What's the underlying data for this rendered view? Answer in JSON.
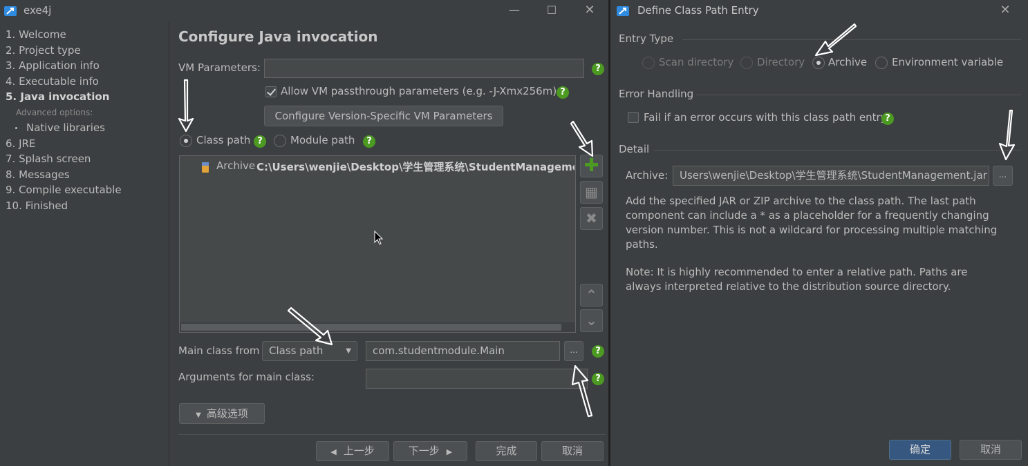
{
  "left_window": {
    "title": "exe4j",
    "nav": {
      "items": [
        "1. Welcome",
        "2. Project type",
        "3. Application info",
        "4. Executable info",
        "5. Java invocation"
      ],
      "advanced_label": "Advanced options:",
      "sub_item": "Native libraries",
      "items_after": [
        "6. JRE",
        "7. Splash screen",
        "8. Messages",
        "9. Compile executable",
        "10. Finished"
      ],
      "active_index": 4
    },
    "panel": {
      "title": "Configure Java invocation",
      "vm_params_label": "VM Parameters:",
      "vm_params_value": "",
      "passthrough_label": "Allow VM passthrough parameters (e.g. -J-Xmx256m)",
      "passthrough_checked": true,
      "configure_version_button": "Configure Version-Specific VM Parameters",
      "class_path_label": "Class path",
      "module_path_label": "Module path",
      "selected_path_mode": "Class path",
      "entry_type": "Archive",
      "entry_path": "C:\\Users\\wenjie\\Desktop\\学生管理系统\\StudentManagement.j",
      "main_class_from_label": "Main class from",
      "main_class_from_value": "Class path",
      "main_class_value": "com.studentmodule.Main",
      "browse_label": "...",
      "arguments_label": "Arguments for main class:",
      "arguments_value": "",
      "advanced_button": "高级选项"
    },
    "footer": {
      "back": "上一步",
      "next": "下一步",
      "finish": "完成",
      "cancel": "取消"
    }
  },
  "right_window": {
    "title": "Define Class Path Entry",
    "entry_type_header": "Entry Type",
    "entry_types": [
      "Scan directory",
      "Directory",
      "Archive",
      "Environment variable"
    ],
    "selected_entry_type": "Archive",
    "error_handling_header": "Error Handling",
    "fail_label": "Fail if an error occurs with this class path entry",
    "fail_checked": false,
    "detail_header": "Detail",
    "archive_label": "Archive:",
    "archive_value": "Users\\wenjie\\Desktop\\学生管理系统\\StudentManagement.jar",
    "browse_label": "...",
    "description_1": "Add the specified JAR or ZIP archive to the class path. The last path component can include a * as a placeholder for a frequently changing version number. This is not a wildcard for processing multiple matching paths.",
    "description_2": "Note: It is highly recommended to enter a relative path. Paths are always interpreted relative to the distribution source directory.",
    "ok": "确定",
    "cancel": "取消"
  },
  "colors": {
    "background": "#3c3f41",
    "field": "#45494a",
    "help_green": "#4c9a22",
    "primary_button": "#365880"
  }
}
